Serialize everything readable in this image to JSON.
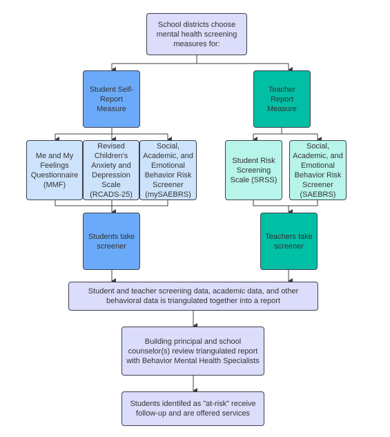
{
  "colors": {
    "lavender": "#dcdcfb",
    "student_blue": "#6aaaf9",
    "student_light_blue": "#cde3fb",
    "teacher_teal": "#01bfa5",
    "teacher_light_teal": "#b7f4e9",
    "connector": "#3d3d4a"
  },
  "nodes": {
    "start": "School districts choose mental health screening measures for:",
    "student_measure": "Student Self-Report Measure",
    "teacher_measure": "Teacher Report Measure",
    "mmf": "Me and My Feelings Questionnaire (MMF)",
    "rcads": "Revised Children's Anxiety and Depression Scale (RCADS-25)",
    "mysaebrs": "Social, Academic, and Emotional Behavior Risk Screener (mySAEBRS)",
    "srss": "Student Risk Screening Scale (SRSS)",
    "saebrs": "Social, Academic, and Emotional Behavior Risk Screener (SAEBRS)",
    "students_take": "Students take screener",
    "teachers_take": "Teachers take screener",
    "triangulate": "Student and teacher screening data, academic data, and other behavioral data is triangulated together into a report",
    "review": "Building principal and school counselor(s) review triangulated report with Behavior Mental Health Specialists",
    "followup": "Students identifed as \"at-risk\" receive follow-up and are offered services"
  }
}
